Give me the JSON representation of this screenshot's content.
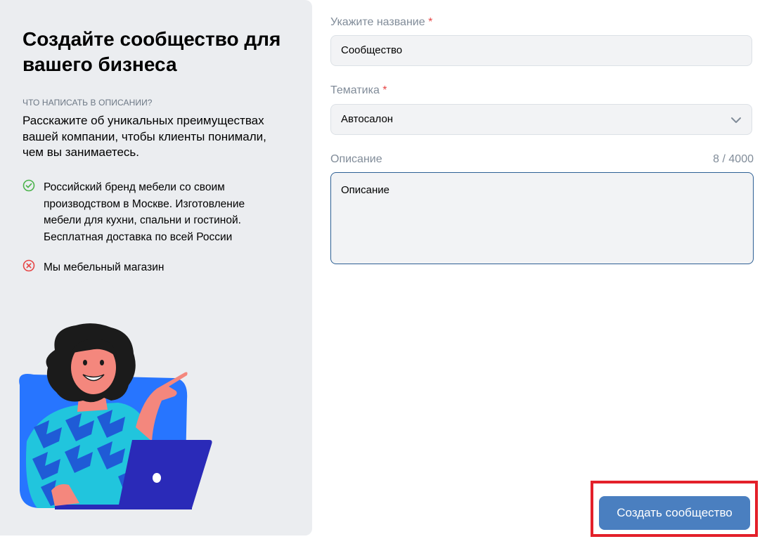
{
  "info": {
    "title": "Создайте сообщество для вашего бизнеса",
    "hint_label": "ЧТО НАПИСАТЬ В ОПИСАНИИ?",
    "hint_text": "Расскажите об уникальных преимуществах вашей компании, чтобы клиенты понимали, чем вы занимаетесь.",
    "good_example": {
      "icon": "check-circle-icon",
      "text": "Российский бренд мебели со своим производством в Москве. Изготовление мебели для кухни, спальни и гостиной. Бесплатная доставка по всей России"
    },
    "bad_example": {
      "icon": "cross-circle-icon",
      "text": "Мы мебельный магазин"
    }
  },
  "form": {
    "name": {
      "label": "Укажите название",
      "required_mark": "*",
      "value": "Сообщество"
    },
    "theme": {
      "label": "Тематика",
      "required_mark": "*",
      "value": "Автосалон",
      "icon": "chevron-down-icon"
    },
    "description": {
      "label": "Описание",
      "counter": "8 / 4000",
      "value": "Описание"
    },
    "submit_label": "Создать сообщество"
  },
  "colors": {
    "panel_bg": "#ebedf0",
    "accent_button": "#4a7fc0",
    "highlight_frame": "#e3202a",
    "required": "#e64646",
    "good": "#4bb34b",
    "bad": "#e64646"
  }
}
